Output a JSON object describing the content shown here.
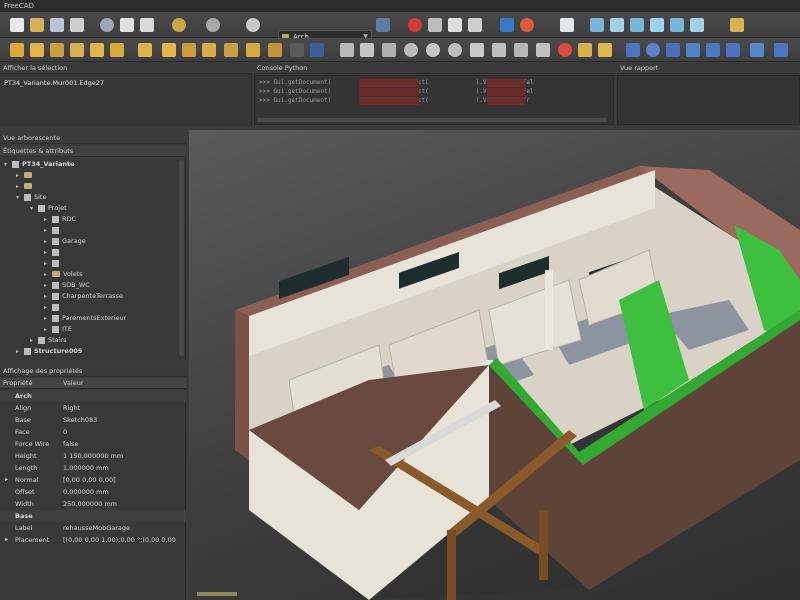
{
  "app": {
    "title": "FreeCAD"
  },
  "toolbar": {
    "workbench": "Arch",
    "row1_icons": [
      "new-file-icon",
      "open-icon",
      "save-icon",
      "print-icon",
      "cut-icon",
      "copy-icon",
      "paste-icon",
      "undo-icon",
      "redo-icon",
      "refresh-icon",
      "pointer-icon",
      "macro-record-icon",
      "macro-stop-icon",
      "macro-edit-icon",
      "macro-run-icon",
      "zoom-fit-icon",
      "draw-style-icon",
      "view-isometric-icon",
      "view-front-icon",
      "view-top-icon",
      "view-right-icon",
      "view-rear-icon",
      "view-bottom-icon",
      "view-left-icon",
      "measure-icon"
    ],
    "row2_icons": [
      "wall-icon",
      "structure-icon",
      "rebar-icon",
      "floor-icon",
      "building-icon",
      "site-icon",
      "window-icon",
      "roof-icon",
      "axis-icon",
      "section-plane-icon",
      "space-icon",
      "stairs-icon",
      "panel-icon",
      "equipment-icon",
      "frame-icon",
      "line-icon",
      "wire-icon",
      "fillet-icon",
      "arc-icon",
      "circle-icon",
      "ellipse-icon",
      "rectangle-icon",
      "polygon-icon",
      "bspline-icon",
      "bezier-icon",
      "point-icon",
      "shapestring-icon",
      "facebinder-icon",
      "move-icon",
      "rotate-icon",
      "offset-icon",
      "trim-icon",
      "upgrade-icon",
      "downgrade-icon",
      "scale-icon",
      "edit-icon"
    ]
  },
  "selection_panel": {
    "title": "Afficher la sélection",
    "value": "PT34_Variante.Mur001.Edge27"
  },
  "python_console": {
    "title": "Console Python",
    "lines": [
      ">>> Gui.getDocument(               ).getObject(             ).Visibility=Fal",
      ">>> Gui.getDocument(               ).getObject(             ).Visibility=Fal",
      ">>> Gui.getDocument(               ).getObject(             ).Visibility=Tr"
    ]
  },
  "report_panel": {
    "title": "Vue rapport"
  },
  "tree_panel": {
    "title": "Vue arborescente",
    "tab": "Étiquettes & attributs",
    "items": [
      {
        "label": "PT34_Variante",
        "level": 0,
        "type": "doc",
        "bold": true
      },
      {
        "label": "",
        "level": 1,
        "type": "folder"
      },
      {
        "label": "",
        "level": 1,
        "type": "folder"
      },
      {
        "label": "Site",
        "level": 1,
        "type": "site"
      },
      {
        "label": "Projet",
        "level": 2,
        "type": "building"
      },
      {
        "label": "RDC",
        "level": 3,
        "type": "floor"
      },
      {
        "label": "",
        "level": 3,
        "type": "floor"
      },
      {
        "label": "Garage",
        "level": 3,
        "type": "floor"
      },
      {
        "label": "",
        "level": 3,
        "type": "floor"
      },
      {
        "label": "",
        "level": 3,
        "type": "floor"
      },
      {
        "label": "Volets",
        "level": 3,
        "type": "folder"
      },
      {
        "label": "SDB_WC",
        "level": 3,
        "type": "floor"
      },
      {
        "label": "CharpenteTerrasse",
        "level": 3,
        "type": "floor"
      },
      {
        "label": "",
        "level": 3,
        "type": "floor"
      },
      {
        "label": "ParementsExterieur",
        "level": 3,
        "type": "floor"
      },
      {
        "label": "ITE",
        "level": 3,
        "type": "floor"
      },
      {
        "label": "Stairs",
        "level": 1,
        "type": "stairs"
      },
      {
        "label": "Structure005",
        "level": 0,
        "type": "structure",
        "bold": true
      }
    ]
  },
  "property_panel": {
    "title": "Affichage des propriétés",
    "col_property": "Propriété",
    "col_value": "Valeur",
    "rows": [
      {
        "group": true,
        "key": "Arch"
      },
      {
        "key": "Align",
        "value": "Right"
      },
      {
        "key": "Base",
        "value": "Sketch083"
      },
      {
        "key": "Face",
        "value": "0"
      },
      {
        "key": "Force Wire",
        "value": "false"
      },
      {
        "key": "Height",
        "value": "1 150,000000 mm"
      },
      {
        "key": "Length",
        "value": "1,000000 mm"
      },
      {
        "key": "Normal",
        "value": "[0,00 0,00 0,00]",
        "expander": true
      },
      {
        "key": "Offset",
        "value": "0,000000 mm"
      },
      {
        "key": "Width",
        "value": "250,000000 mm"
      },
      {
        "group": true,
        "key": "Base"
      },
      {
        "key": "Label",
        "value": "rehausseMobGarage"
      },
      {
        "key": "Placement",
        "value": "[(0,00 0,00 1,00);0,00 °;(0,00 0,00",
        "expander": true
      }
    ]
  },
  "colors": {
    "selected_wall": "#3fbf3f",
    "roof": "#8c5f55",
    "wall": "#e8e3d8",
    "floor": "#8c94a0",
    "beam": "#8b5a2b"
  }
}
